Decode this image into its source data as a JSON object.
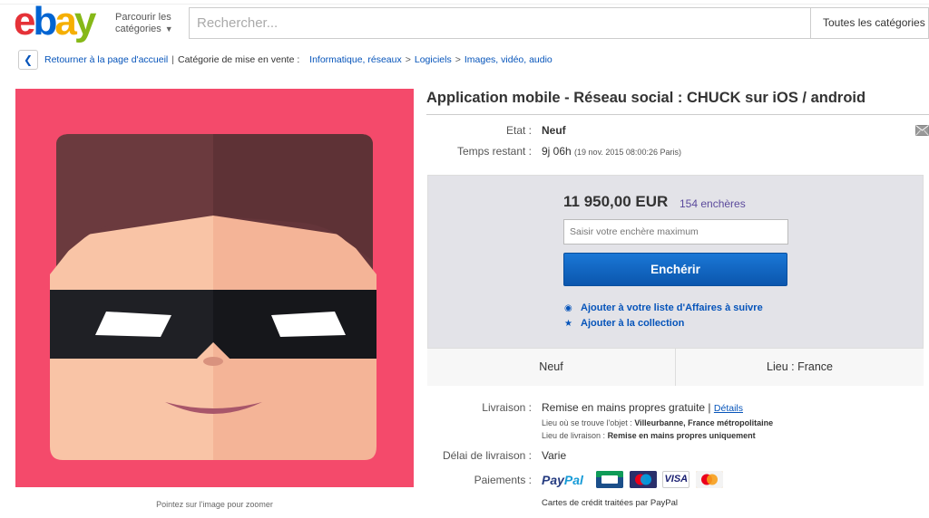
{
  "header": {
    "logo_letters": [
      "e",
      "b",
      "a",
      "y"
    ],
    "browse_line1": "Parcourir les",
    "browse_line2": "catégories",
    "search_placeholder": "Rechercher...",
    "category_select": "Toutes les catégories"
  },
  "breadcrumb": {
    "back": "Retourner à la page d'accueil",
    "category_label": "Catégorie de mise en vente :",
    "items": [
      "Informatique, réseaux",
      "Logiciels",
      "Images, vidéo, audio"
    ]
  },
  "product": {
    "title": "Application mobile - Réseau social : CHUCK sur iOS / android",
    "zoom_hint": "Pointez sur l'image pour zoomer",
    "condition_label": "Etat :",
    "condition_value": "Neuf",
    "time_label": "Temps restant :",
    "time_value": "9j 06h",
    "time_detail": "(19 nov. 2015  08:00:26 Paris)"
  },
  "bid": {
    "price": "11 950,00 EUR",
    "bids": "154 enchères",
    "input_placeholder": "Saisir votre enchère maximum",
    "button": "Enchérir",
    "watch_link": "Ajouter à votre liste d'Affaires à suivre",
    "collection_link": "Ajouter à la collection",
    "condition_cell": "Neuf",
    "location_cell": "Lieu : France"
  },
  "shipping": {
    "label": "Livraison :",
    "value": "Remise en mains propres gratuite |",
    "details_link": "Détails",
    "location_line_label": "Lieu où se trouve l'objet :",
    "location_line_value": "Villeurbanne, France métropolitaine",
    "delivery_line_label": "Lieu de livraison :",
    "delivery_line_value": "Remise en mains propres uniquement",
    "delay_label": "Délai de livraison :",
    "delay_value": "Varie",
    "payments_label": "Paiements :",
    "paypal_part1": "Pay",
    "paypal_part2": "Pal",
    "visa": "VISA",
    "card_note": "Cartes de crédit traitées par PayPal"
  },
  "colors": {
    "image_background": "#f44a6b",
    "link_blue": "#0654ba",
    "button_blue": "#0f64c6",
    "bid_panel": "#e3e3e8"
  }
}
